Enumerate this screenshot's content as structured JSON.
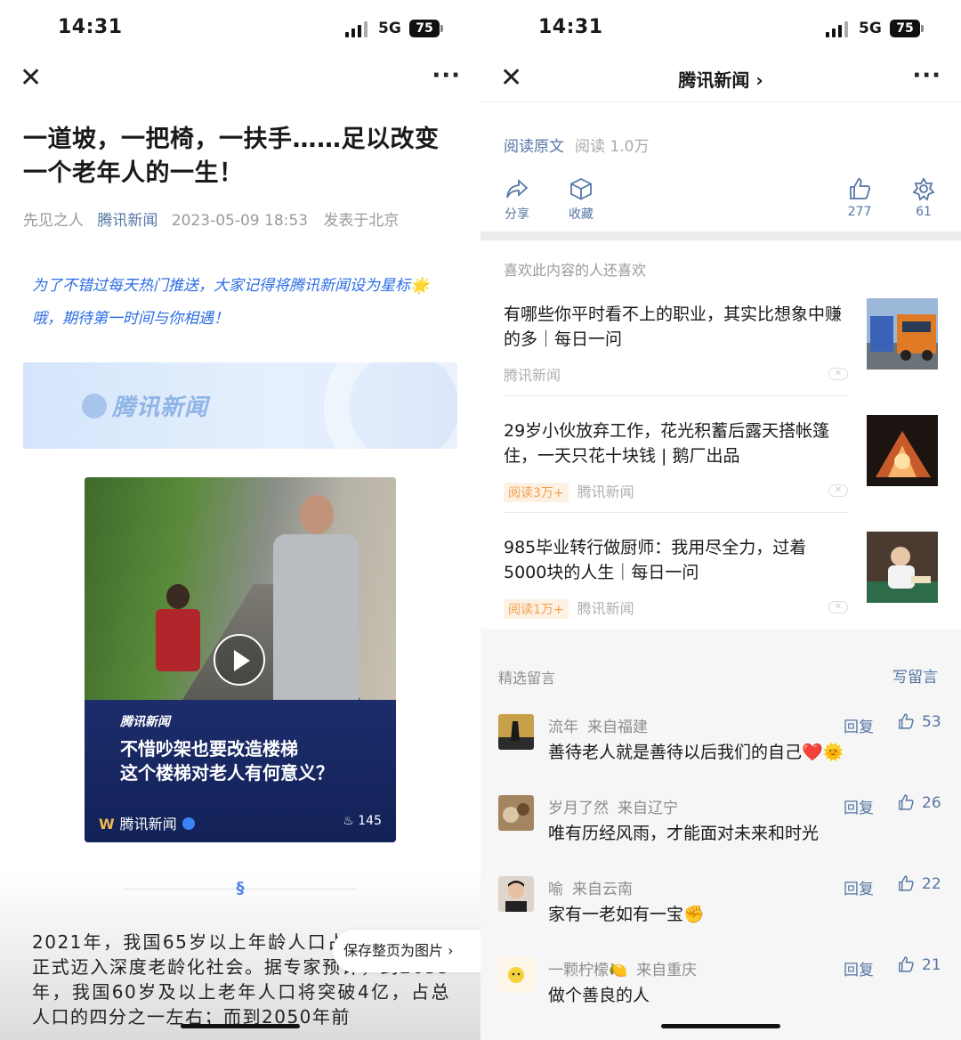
{
  "status_bar": {
    "time": "14:31",
    "network": "5G",
    "battery": "75"
  },
  "left": {
    "article_title": "一道坡，一把椅，一扶手……足以改变一个老年人的一生！",
    "meta": {
      "author": "先见之人",
      "source": "腾讯新闻",
      "datetime": "2023-05-09 18:53",
      "location": "发表于北京"
    },
    "notice": "为了不错过每天热门推送，大家记得将腾讯新闻设为星标🌟哦，期待第一时间与你相遇！",
    "banner_logo": "腾讯新闻",
    "video": {
      "logo": "腾讯新闻",
      "headline": "不惜吵架也要改造楼梯\n这个楼梯对老人有何意义？",
      "source": "腾讯新闻",
      "count": "145"
    },
    "body_text": "2021年，我国65岁以上年龄人口占比14.2%，正式迈入深度老龄化社会。据专家预计，到2035年，我国60岁及以上老年人口将突破4亿，占总人口的四分之一左右；而到2050年前",
    "save_button": "保存整页为图片 ›"
  },
  "right": {
    "nav_title": "腾讯新闻 ›",
    "read_original": "阅读原文",
    "read_count": "阅读 1.0万",
    "actions": {
      "share": "分享",
      "collect": "收藏",
      "like_count": "277",
      "wow_count": "61"
    },
    "recommend_header": "喜欢此内容的人还喜欢",
    "recommendations": [
      {
        "title": "有哪些你平时看不上的职业，其实比想象中赚的多｜每日一问",
        "tag": "",
        "source": "腾讯新闻"
      },
      {
        "title": "29岁小伙放弃工作，花光积蓄后露天搭帐篷住，一天只花十块钱 | 鹅厂出品",
        "tag": "阅读3万+",
        "source": "腾讯新闻"
      },
      {
        "title": "985毕业转行做厨师：我用尽全力，过着5000块的人生｜每日一问",
        "tag": "阅读1万+",
        "source": "腾讯新闻"
      }
    ],
    "comments_header": "精选留言",
    "write_comment": "写留言",
    "comments": [
      {
        "name": "流年",
        "from": "来自福建",
        "text": "善待老人就是善待以后我们的自己❤️🌞",
        "reply": "回复",
        "likes": "53"
      },
      {
        "name": "岁月了然",
        "from": "来自辽宁",
        "text": "唯有历经风雨，才能面对未来和时光",
        "reply": "回复",
        "likes": "26"
      },
      {
        "name": "喻",
        "from": "来自云南",
        "text": "家有一老如有一宝✊",
        "reply": "回复",
        "likes": "22"
      },
      {
        "name": "一颗柠檬🍋",
        "from": "来自重庆",
        "text": "做个善良的人",
        "reply": "回复",
        "likes": "21"
      }
    ]
  },
  "colors": {
    "link": "#5576a4",
    "notice": "#2d6ee5",
    "tag_bg": "#fdf1e4",
    "tag_text": "#f3a04c"
  }
}
